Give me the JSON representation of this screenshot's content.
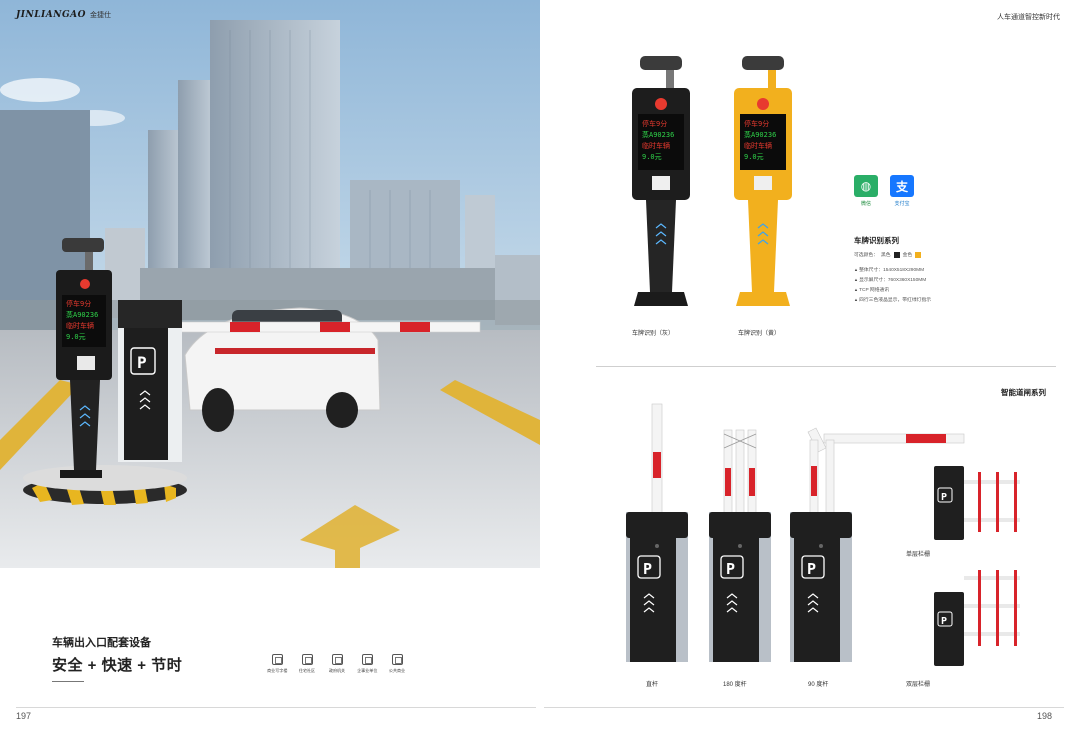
{
  "brand": {
    "mark": "JINLIANGAO",
    "cn": "金捷仕"
  },
  "left": {
    "heading": "车辆出入口配套设备",
    "slogan": "安全 + 快速 + 节时",
    "page_number": "197",
    "screen_lines": [
      "停车9分",
      "蒸A90236",
      "临时车辆",
      "9.0元"
    ],
    "scenes": [
      {
        "label": "商业写字楼",
        "icon": "office-building-icon"
      },
      {
        "label": "住宅社区",
        "icon": "residential-icon"
      },
      {
        "label": "政府机关",
        "icon": "government-icon"
      },
      {
        "label": "企事业单位",
        "icon": "enterprise-icon"
      },
      {
        "label": "公共商业",
        "icon": "public-commerce-icon"
      }
    ]
  },
  "right": {
    "tagline": "人车通道智控新时代",
    "page_number": "198",
    "devices": [
      {
        "caption": "车牌识别（灰）",
        "color": "#2c2c2c",
        "screen_lines": [
          "停车9分",
          "蒸A90236",
          "临时车辆",
          "9.0元"
        ]
      },
      {
        "caption": "车牌识别（黄）",
        "color": "#f2b01e",
        "screen_lines": [
          "停车9分",
          "蒸A90236",
          "临时车辆",
          "9.0元"
        ]
      }
    ],
    "payments": [
      {
        "label": "微信",
        "glyph": "◍",
        "color": "#2aae67",
        "icon": "wechat-pay-icon"
      },
      {
        "label": "支付宝",
        "glyph": "支",
        "color": "#1677ff",
        "icon": "alipay-icon"
      }
    ],
    "series": {
      "title": "车牌识别系列",
      "colors_label": "可选颜色：",
      "color_black": "黑色",
      "color_gold": "金色",
      "specs": [
        "整体尺寸：1540X518X290MM",
        "显示屏尺寸：760X360X150MM",
        "TCP 网络通讯",
        "四行三色液晶显示，带红绿灯指示"
      ]
    },
    "barrier_series_title": "智能道闸系列",
    "gates": [
      {
        "caption": "直杆"
      },
      {
        "caption": "180 度杆"
      },
      {
        "caption": "90 度杆"
      },
      {
        "caption": "单层栏栅"
      },
      {
        "caption": "双层栏栅"
      }
    ]
  },
  "colors": {
    "gate_body": "#1f1f1f",
    "gate_side": "#b9c0c8",
    "boom_red": "#d8232a",
    "led_red": "#e83a2f",
    "led_green": "#2fd34a"
  }
}
